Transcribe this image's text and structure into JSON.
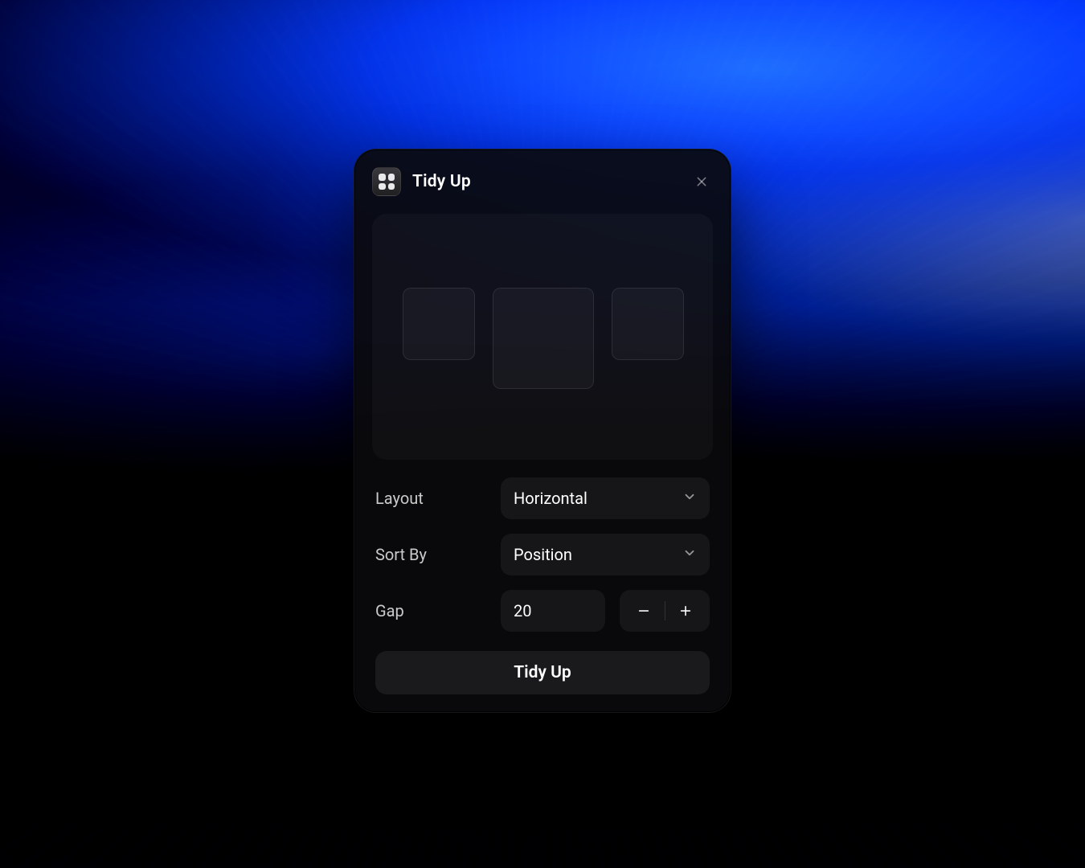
{
  "modal": {
    "title": "Tidy Up",
    "fields": {
      "layout_label": "Layout",
      "layout_value": "Horizontal",
      "sortby_label": "Sort By",
      "sortby_value": "Position",
      "gap_label": "Gap",
      "gap_value": "20"
    },
    "primary_button": "Tidy Up"
  }
}
